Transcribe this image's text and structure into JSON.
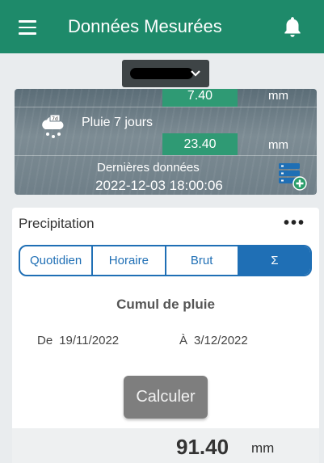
{
  "header": {
    "title": "Données Mesurées",
    "menu_icon": "hamburger-icon",
    "notify_icon": "bell-icon"
  },
  "station_selector": {
    "value": "",
    "icon": "chevron-down-icon"
  },
  "rain_summary": {
    "top_value": "7.40",
    "top_unit": "mm",
    "seven_day_label": "Pluie 7 jours",
    "seven_day_value": "23.40",
    "seven_day_unit": "mm",
    "last_data_label": "Dernières données",
    "last_data_date": "2022-12-03 18:00:06",
    "rain_icon": "rain-7-days-icon",
    "add_data_icon": "database-add-icon"
  },
  "precipitation": {
    "title": "Precipitation",
    "more_icon": "more-icon",
    "tabs": [
      {
        "label": "Quotidien",
        "active": false
      },
      {
        "label": "Horaire",
        "active": false
      },
      {
        "label": "Brut",
        "active": false
      },
      {
        "label": "Σ",
        "active": true
      }
    ],
    "cumul_title": "Cumul de pluie",
    "from_label": "De",
    "from_date": "19/11/2022",
    "to_label": "À",
    "to_date": "3/12/2022",
    "calc_button": "Calculer",
    "result_value": "91.40",
    "result_unit": "mm"
  },
  "colors": {
    "header": "#1e8a6a",
    "value_box": "#2f9a74",
    "tab_accent": "#1f6fb5",
    "button": "#7e7e7e"
  }
}
